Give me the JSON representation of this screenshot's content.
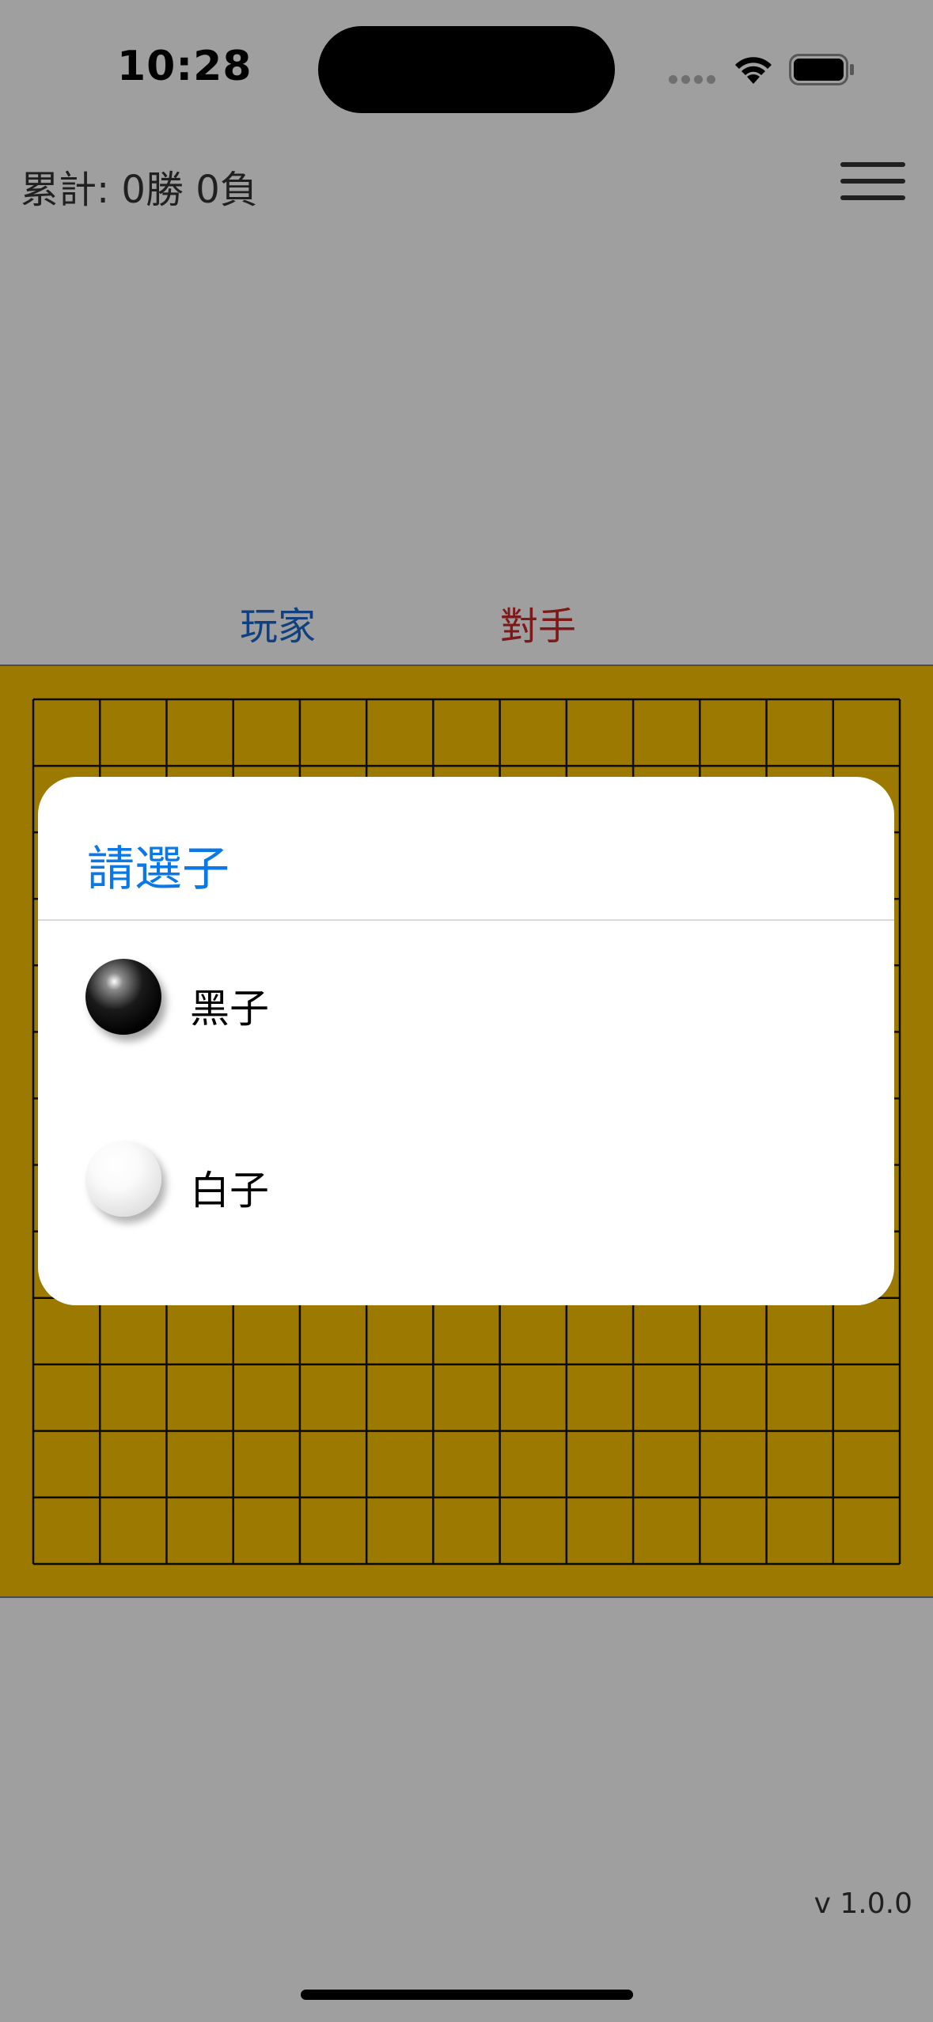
{
  "status_bar": {
    "time": "10:28",
    "icons": [
      "signal-dots-icon",
      "wifi-icon",
      "battery-icon"
    ]
  },
  "header": {
    "record_text": "累計: 0勝 0負",
    "menu_icon": "hamburger-menu-icon"
  },
  "players": {
    "me_label": "玩家",
    "opponent_label": "對手",
    "me_color": "#1a64c8",
    "opponent_color": "#c42828"
  },
  "board": {
    "color": "#f4bd00",
    "grid_size": 13
  },
  "footer": {
    "version": "v 1.0.0"
  },
  "dialog": {
    "title": "請選子",
    "title_color": "#0a78e6",
    "options": [
      {
        "label": "黑子",
        "stone": "black-stone-icon"
      },
      {
        "label": "白子",
        "stone": "white-stone-icon"
      }
    ]
  }
}
